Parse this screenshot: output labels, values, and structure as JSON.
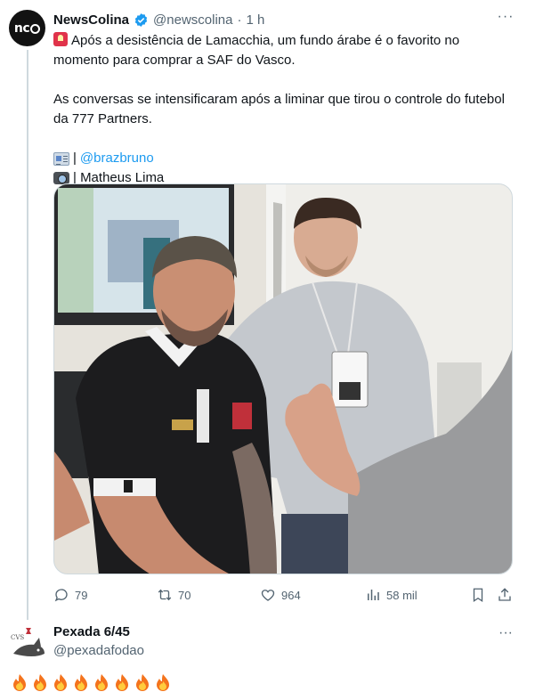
{
  "tweet": {
    "display_name": "NewsColina",
    "handle": "@newscolina",
    "separator": "·",
    "time": "1 h",
    "avatar_text": "nc",
    "verified_icon": "verified-badge-icon",
    "line1": "Após a desistência de Lamacchia, um fundo árabe é o favorito no momento para comprar a SAF do Vasco.",
    "line2": "As conversas se intensificaram após a liminar que tirou o controle do futebol da 777 Partners.",
    "credit_text_prefix": "|",
    "credit_text_handle": "@brazbruno",
    "photo_credit": "| Matheus Lima",
    "image_alt": "Two men standing in a room; one in a black Vasco polo shirt, another in a light blue shirt with a badge, and a person gesturing in the foreground"
  },
  "actions": {
    "replies": "79",
    "retweets": "70",
    "likes": "964",
    "views": "58 mil"
  },
  "reply": {
    "display_name": "Pexada 6/45",
    "handle": "@pexadafodao",
    "fire_count": 8
  },
  "colors": {
    "accent": "#1d9bf0",
    "secondary_text": "#536471",
    "verified": "#1d9bf0"
  }
}
